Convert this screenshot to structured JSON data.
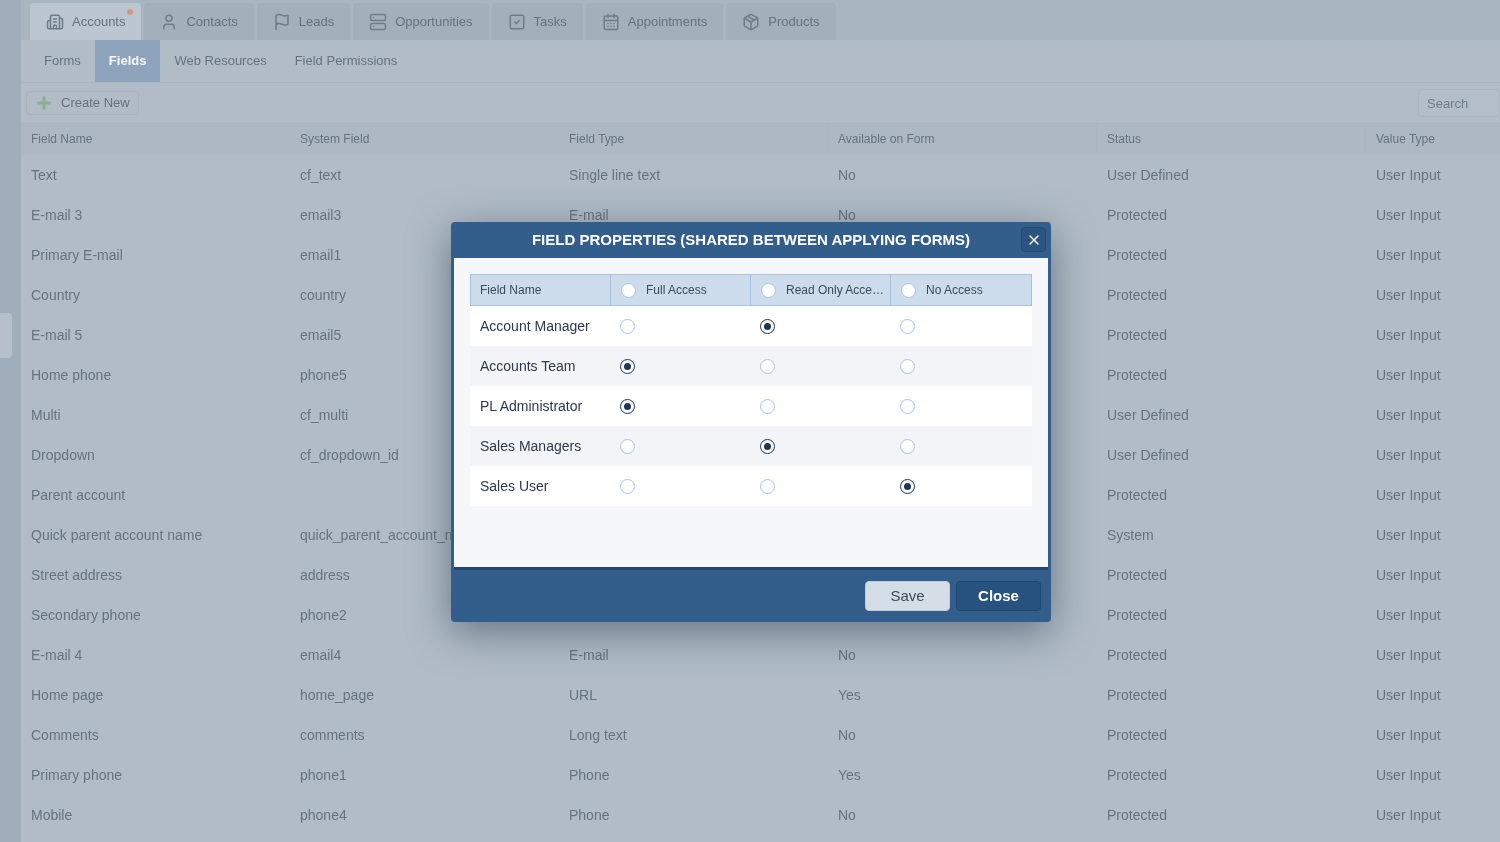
{
  "top_tabs": [
    {
      "kind": "building",
      "label": "Accounts",
      "selected": true,
      "notification": true
    },
    {
      "kind": "person",
      "label": "Contacts",
      "selected": false,
      "notification": false
    },
    {
      "kind": "flag",
      "label": "Leads",
      "selected": false,
      "notification": false
    },
    {
      "kind": "stack",
      "label": "Opportunities",
      "selected": false,
      "notification": false
    },
    {
      "kind": "check",
      "label": "Tasks",
      "selected": false,
      "notification": false
    },
    {
      "kind": "calendar",
      "label": "Appointments",
      "selected": false,
      "notification": false
    },
    {
      "kind": "box",
      "label": "Products",
      "selected": false,
      "notification": false
    }
  ],
  "sub_tabs": [
    {
      "label": "Forms",
      "selected": false
    },
    {
      "label": "Fields",
      "selected": true
    },
    {
      "label": "Web Resources",
      "selected": false
    },
    {
      "label": "Field Permissions",
      "selected": false
    }
  ],
  "toolbar": {
    "create_button": "Create New",
    "search": {
      "placeholder": "Search"
    }
  },
  "table": {
    "columns": [
      "Field Name",
      "System Field",
      "Field Type",
      "Available on Form",
      "Status",
      "Value Type"
    ],
    "rows": [
      [
        "Text",
        "cf_text",
        "Single line text",
        "No",
        "User Defined",
        "User Input"
      ],
      [
        "E-mail 3",
        "email3",
        "E-mail",
        "No",
        "Protected",
        "User Input"
      ],
      [
        "Primary E-mail",
        "email1",
        null,
        null,
        "Protected",
        "User Input"
      ],
      [
        "Country",
        "country",
        null,
        null,
        "Protected",
        "User Input"
      ],
      [
        "E-mail 5",
        "email5",
        null,
        null,
        "Protected",
        "User Input"
      ],
      [
        "Home phone",
        "phone5",
        null,
        null,
        "Protected",
        "User Input"
      ],
      [
        "Multi",
        "cf_multi",
        null,
        null,
        "User Defined",
        "User Input"
      ],
      [
        "Dropdown",
        "cf_dropdown_id",
        null,
        null,
        "User Defined",
        "User Input"
      ],
      [
        "Parent account",
        null,
        null,
        null,
        "Protected",
        "User Input"
      ],
      [
        "Quick parent account name",
        "quick_parent_account_n",
        null,
        null,
        "System",
        "User Input"
      ],
      [
        "Street address",
        "address",
        null,
        null,
        "Protected",
        "User Input"
      ],
      [
        "Secondary phone",
        "phone2",
        null,
        null,
        "Protected",
        "User Input"
      ],
      [
        "E-mail 4",
        "email4",
        "E-mail",
        "No",
        "Protected",
        "User Input"
      ],
      [
        "Home page",
        "home_page",
        "URL",
        "Yes",
        "Protected",
        "User Input"
      ],
      [
        "Comments",
        "comments",
        "Long text",
        "No",
        "Protected",
        "User Input"
      ],
      [
        "Primary phone",
        "phone1",
        "Phone",
        "Yes",
        "Protected",
        "User Input"
      ],
      [
        "Mobile",
        "phone4",
        "Phone",
        "No",
        "Protected",
        "User Input"
      ]
    ]
  },
  "dialog": {
    "title": "FIELD PROPERTIES (SHARED BETWEEN APPLYING FORMS)",
    "name_column": "Field Name",
    "access_columns": [
      {
        "label": "Full Access",
        "selected": false
      },
      {
        "label": "Read Only Acce…",
        "selected": false
      },
      {
        "label": "No Access",
        "selected": false
      }
    ],
    "rows": [
      {
        "name": "Account Manager",
        "options": [
          {
            "selected": false
          },
          {
            "selected": true
          },
          {
            "selected": false
          }
        ]
      },
      {
        "name": "Accounts Team",
        "options": [
          {
            "selected": true
          },
          {
            "selected": false
          },
          {
            "selected": false
          }
        ]
      },
      {
        "name": "PL Administrator",
        "options": [
          {
            "selected": true
          },
          {
            "selected": false
          },
          {
            "selected": false
          }
        ]
      },
      {
        "name": "Sales Managers",
        "options": [
          {
            "selected": false
          },
          {
            "selected": true
          },
          {
            "selected": false
          }
        ]
      },
      {
        "name": "Sales User",
        "options": [
          {
            "selected": false
          },
          {
            "selected": false
          },
          {
            "selected": true
          }
        ]
      }
    ],
    "buttons": [
      {
        "kind": "secondary",
        "label": "Save"
      },
      {
        "kind": "primary",
        "label": "Close"
      }
    ]
  }
}
